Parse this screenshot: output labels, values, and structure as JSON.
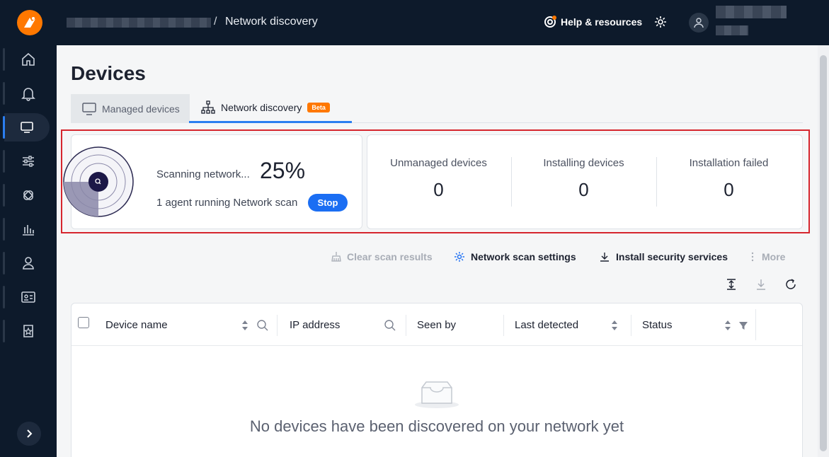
{
  "header": {
    "breadcrumb_current": "Network discovery",
    "breadcrumb_separator": "/",
    "help_label": "Help & resources"
  },
  "sidebar": {
    "items": [
      {
        "icon": "home-icon"
      },
      {
        "icon": "bell-icon"
      },
      {
        "icon": "monitor-icon",
        "active": true
      },
      {
        "icon": "sliders-icon"
      },
      {
        "icon": "patch-icon"
      },
      {
        "icon": "reports-icon"
      },
      {
        "icon": "user-icon"
      },
      {
        "icon": "id-card-icon"
      },
      {
        "icon": "badge-star-icon"
      }
    ]
  },
  "page": {
    "title": "Devices",
    "tabs": [
      {
        "label": "Managed devices",
        "active": false
      },
      {
        "label": "Network discovery",
        "active": true,
        "badge": "Beta"
      }
    ]
  },
  "scan": {
    "label": "Scanning network...",
    "percent": "25%",
    "progress_fraction": 0.25,
    "agents_text": "1 agent running Network scan",
    "stop_label": "Stop"
  },
  "stats": [
    {
      "label": "Unmanaged devices",
      "value": "0"
    },
    {
      "label": "Installing devices",
      "value": "0"
    },
    {
      "label": "Installation failed",
      "value": "0"
    }
  ],
  "actions": {
    "clear": "Clear scan results",
    "settings": "Network scan settings",
    "install": "Install security services",
    "more": "More"
  },
  "table": {
    "columns": [
      "Device name",
      "IP address",
      "Seen by",
      "Last detected",
      "Status"
    ],
    "empty_message": "No devices have been discovered on your network yet"
  },
  "colors": {
    "accent": "#2b7ef0",
    "brand": "#ff7800",
    "sidebar_bg": "#0d1a2b",
    "highlight": "#d6262e"
  }
}
